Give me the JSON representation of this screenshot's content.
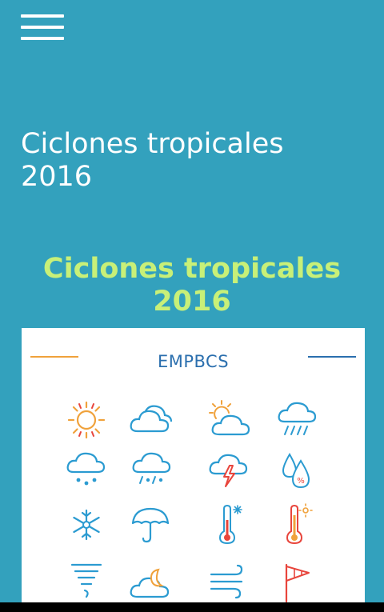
{
  "header": {
    "menu_icon": "hamburger-menu-icon"
  },
  "page": {
    "title_line1": "Ciclones tropicales",
    "title_line2": "2016",
    "subtitle_line1": "Ciclones tropicales",
    "subtitle_line2": "2016"
  },
  "card": {
    "brand": "EMPBCS"
  },
  "colors": {
    "background": "#33a1bd",
    "subtitle": "#c8f078",
    "brand": "#2b6fae",
    "orange": "#f0a23c",
    "red": "#e8453c",
    "blue": "#2b9bd1"
  },
  "weather_icons": [
    "sun-icon",
    "cloudy-icon",
    "partly-cloudy-icon",
    "rain-cloud-icon",
    "snow-cloud-icon",
    "sleet-cloud-icon",
    "thunderstorm-icon",
    "humidity-icon",
    "snowflake-icon",
    "umbrella-icon",
    "thermometer-cold-icon",
    "thermometer-hot-icon",
    "tornado-icon",
    "cloud-moon-icon",
    "wind-icon",
    "windsock-icon"
  ]
}
